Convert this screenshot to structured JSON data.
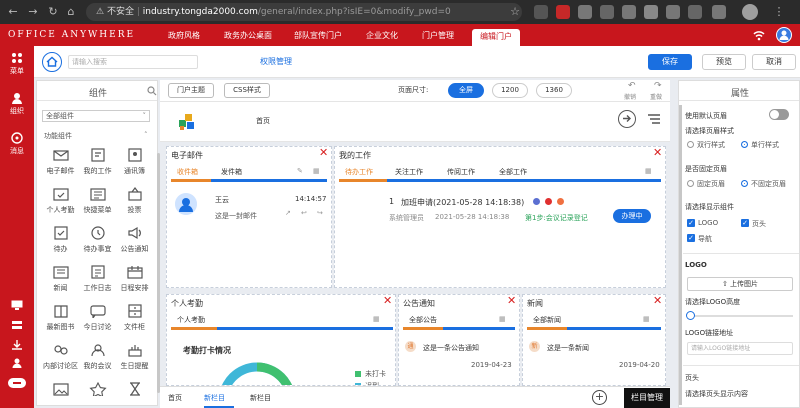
{
  "browser": {
    "security_label": "不安全",
    "url_host": "industry.tongda2000.com",
    "url_path": "/general/index.php?isIE=0&modify_pwd=0"
  },
  "app": {
    "brand": "OFFICE ANYWHERE",
    "top_menu": [
      "政府风格",
      "政务办公桌面",
      "部队宣传门户",
      "企业文化",
      "门户管理",
      "编辑门户"
    ],
    "active_menu_index": 5
  },
  "left_nav": [
    {
      "label": "菜单",
      "icon": "grid-icon"
    },
    {
      "label": "组织",
      "icon": "org-icon"
    },
    {
      "label": "消息",
      "icon": "message-icon"
    }
  ],
  "toolbar": {
    "search_placeholder": "请输入搜索",
    "permission_link": "权限管理",
    "save_label": "保存",
    "preview_label": "预览",
    "cancel_label": "取消"
  },
  "components_panel": {
    "title": "组件",
    "category_select": "全部组件",
    "section_label": "功能组件",
    "items": [
      {
        "label": "电子邮件",
        "icon": "email-icon"
      },
      {
        "label": "我的工作",
        "icon": "work-icon"
      },
      {
        "label": "通讯簿",
        "icon": "contacts-icon"
      },
      {
        "label": "个人考勤",
        "icon": "attendance-icon"
      },
      {
        "label": "快捷菜单",
        "icon": "shortcut-icon"
      },
      {
        "label": "投票",
        "icon": "vote-icon"
      },
      {
        "label": "待办",
        "icon": "todo-icon"
      },
      {
        "label": "待办事宜",
        "icon": "pending-icon"
      },
      {
        "label": "公告通知",
        "icon": "notice-icon"
      },
      {
        "label": "新闻",
        "icon": "news-icon"
      },
      {
        "label": "工作日志",
        "icon": "log-icon"
      },
      {
        "label": "日程安排",
        "icon": "calendar-icon"
      },
      {
        "label": "最新图书",
        "icon": "book-icon"
      },
      {
        "label": "今日讨论",
        "icon": "discussion-icon"
      },
      {
        "label": "文件柜",
        "icon": "file-cabinet-icon"
      },
      {
        "label": "内部讨论区",
        "icon": "forum-icon"
      },
      {
        "label": "我的会议",
        "icon": "meeting-icon"
      },
      {
        "label": "生日提醒",
        "icon": "birthday-icon"
      },
      {
        "label": "",
        "icon": "image-icon"
      },
      {
        "label": "",
        "icon": "star-icon"
      },
      {
        "label": "",
        "icon": "hourglass-icon"
      }
    ]
  },
  "preview": {
    "btn_portal_theme": "门户主题",
    "btn_css_style": "CSS样式",
    "page_size_label": "页面尺寸:",
    "page_sizes": [
      "全屏",
      "1200",
      "1360"
    ],
    "active_size_index": 0,
    "undo_label": "撤销",
    "redo_label": "重做",
    "home_label": "首页",
    "email_card": {
      "title": "电子邮件",
      "tabs": [
        "收件箱",
        "发件箱"
      ],
      "sender": "王云",
      "time": "14:14:57",
      "subject": "这是一封邮件"
    },
    "work_card": {
      "title": "我的工作",
      "tabs": [
        "待办工作",
        "关注工作",
        "传阅工作",
        "全部工作"
      ],
      "item_index": "1",
      "item_title": "加班申请(2021-05-28 14:18:38)",
      "item_sub": "系统管理员",
      "item_date": "2021-05-28 14:18:38",
      "item_step": "第1步:会议记录登记",
      "item_status": "办理中"
    },
    "attendance_card": {
      "title": "个人考勤",
      "tab": "个人考勤",
      "chart_title": "考勤打卡情况",
      "legend": [
        "未打卡",
        "迟到"
      ]
    },
    "notice_card": {
      "title": "公告通知",
      "tab": "全部公告",
      "badge": "通",
      "item": "这是一条公告通知",
      "date": "2019-04-23"
    },
    "news_card": {
      "title": "新闻",
      "tab": "全部新闻",
      "badge": "新",
      "item": "这是一条新闻",
      "date": "2019-04-20"
    },
    "bottom_tabs": [
      "首页",
      "新栏目",
      "新栏目"
    ],
    "active_bottom_index": 1,
    "column_manage": "栏目管理"
  },
  "properties_panel": {
    "title": "属性",
    "default_header": "使用默认页眉",
    "header_style_label": "请选择页眉样式",
    "header_styles": [
      "双行样式",
      "单行样式"
    ],
    "header_style_selected": 1,
    "fixed_header_label": "是否固定页眉",
    "fixed_options": [
      "固定页眉",
      "不固定页眉"
    ],
    "fixed_selected": 1,
    "show_components_label": "请选择显示组件",
    "show_components": [
      "LOGO",
      "页头",
      "导航"
    ],
    "logo_section": "LOGO",
    "upload_label": "上传图片",
    "logo_height_label": "请选择LOGO高度",
    "logo_link_label": "LOGO链接地址",
    "logo_link_placeholder": "请输入LOGO链接地址",
    "header_section": "页头",
    "header_content_label": "请选择页头显示内容"
  }
}
